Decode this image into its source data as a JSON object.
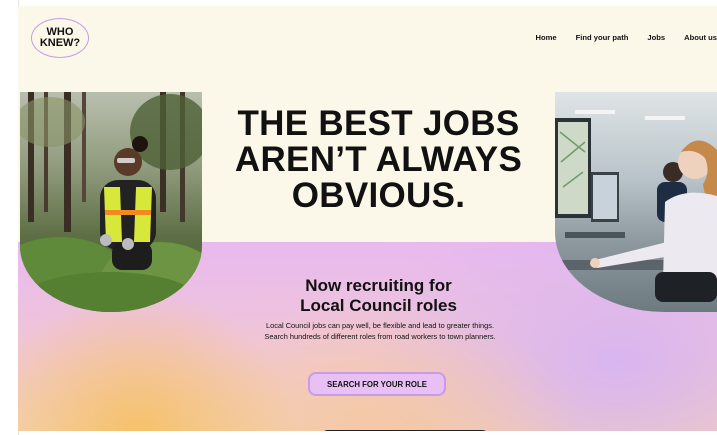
{
  "brand": {
    "logo_line1": "WHO",
    "logo_line2": "KNEW?"
  },
  "nav": {
    "items": [
      {
        "label": "Home"
      },
      {
        "label": "Find your path"
      },
      {
        "label": "Jobs"
      },
      {
        "label": "About us"
      }
    ]
  },
  "hero": {
    "headline_line1": "THE BEST JOBS",
    "headline_line2": "AREN’T ALWAYS",
    "headline_line3": "OBVIOUS."
  },
  "recruiting": {
    "title_line1": "Now recruiting for",
    "title_line2": "Local Council roles",
    "description": "Local Council jobs can pay well, be flexible and lead to greater things. Search hundreds of different roles from road workers to town planners.",
    "cta_label": "SEARCH FOR YOUR ROLE"
  },
  "colors": {
    "background": "#fbf8e9",
    "accent_lilac": "#c99be6",
    "cta_fill": "#e9c0f4",
    "text": "#111111"
  }
}
